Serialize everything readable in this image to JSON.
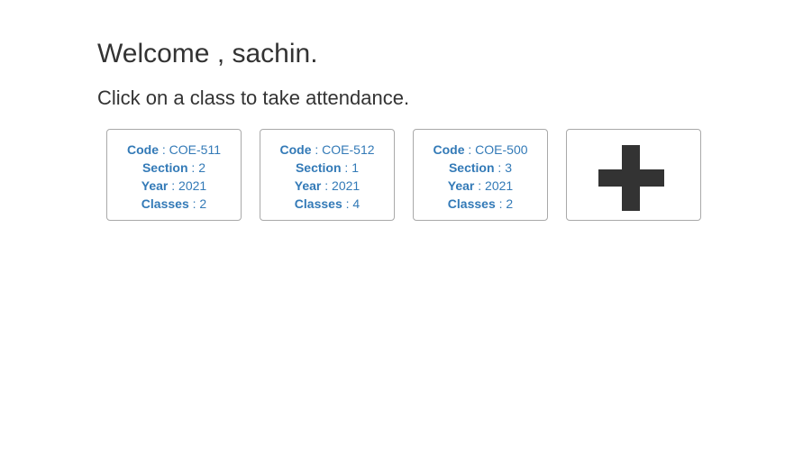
{
  "header": {
    "welcome": "Welcome , sachin.",
    "subtitle": "Click on a class to take attendance."
  },
  "labels": {
    "code": "Code",
    "section": "Section",
    "year": "Year",
    "classes": "Classes",
    "separator": " : "
  },
  "classes": [
    {
      "code": "COE-511",
      "section": "2",
      "year": "2021",
      "classes": "2"
    },
    {
      "code": "COE-512",
      "section": "1",
      "year": "2021",
      "classes": "4"
    },
    {
      "code": "COE-500",
      "section": "3",
      "year": "2021",
      "classes": "2"
    }
  ],
  "add_card": {
    "icon": "plus-icon"
  },
  "colors": {
    "link": "#337ab7",
    "text": "#333333",
    "border": "#a9a9a9"
  }
}
